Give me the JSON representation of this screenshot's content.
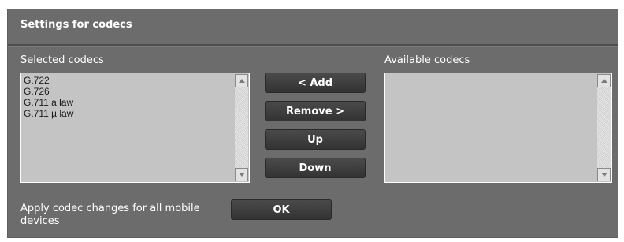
{
  "section": {
    "title": "Settings for codecs"
  },
  "selected": {
    "label": "Selected codecs",
    "items": [
      "G.722",
      "G.726",
      "G.711 a law",
      "G.711 µ law"
    ]
  },
  "available": {
    "label": "Available codecs",
    "items": []
  },
  "buttons": {
    "add": "< Add",
    "remove": "Remove >",
    "up": "Up",
    "down": "Down",
    "ok": "OK"
  },
  "apply": {
    "label": "Apply codec changes for all mobile devices"
  },
  "colors": {
    "panel": "#6c6c6c",
    "listbox": "#c4c4c4",
    "button": "#3c3c3c"
  }
}
